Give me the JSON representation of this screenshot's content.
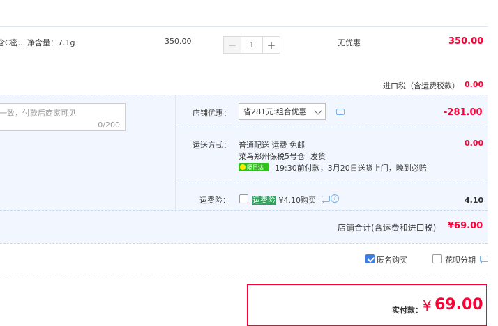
{
  "item": {
    "name": "含C密...",
    "net_content": "净含量：7.1g",
    "unit_price": "350.00",
    "quantity": "1",
    "promo": "无优惠",
    "subtotal": "350.00"
  },
  "tax": {
    "label": "进口税（含运费税款）",
    "value": "0.00"
  },
  "message": {
    "placeholder": "一致，付款后商家可见",
    "counter": "0/200"
  },
  "shop_discount": {
    "label": "店铺优惠：",
    "selected": "省281元:组合优惠",
    "value": "-281.00"
  },
  "shipping": {
    "label": "运送方式：",
    "method": "普通配送 运费 免邮",
    "warehouse": "菜鸟郑州保税5号仓",
    "ship_word": "发货",
    "badge": "隔日达",
    "eta": "19:30前付款，3月20日送货上门，晚到必赔",
    "value": "0.00"
  },
  "insurance": {
    "label": "运费险：",
    "tag": "运费险",
    "price_text": "¥4.10购买",
    "value": "4.10"
  },
  "shop_total": {
    "label": "店铺合计(含运费和进口税)",
    "value": "¥69.00"
  },
  "options": {
    "anonymous": "匿名购买",
    "huabei": "花呗分期"
  },
  "payment": {
    "label": "实付款：",
    "currency": "¥",
    "amount": "69.00"
  },
  "colors": {
    "accent_red": "#ff0036",
    "blue_bg": "#f2f7ff",
    "check_blue": "#3d7de4"
  }
}
